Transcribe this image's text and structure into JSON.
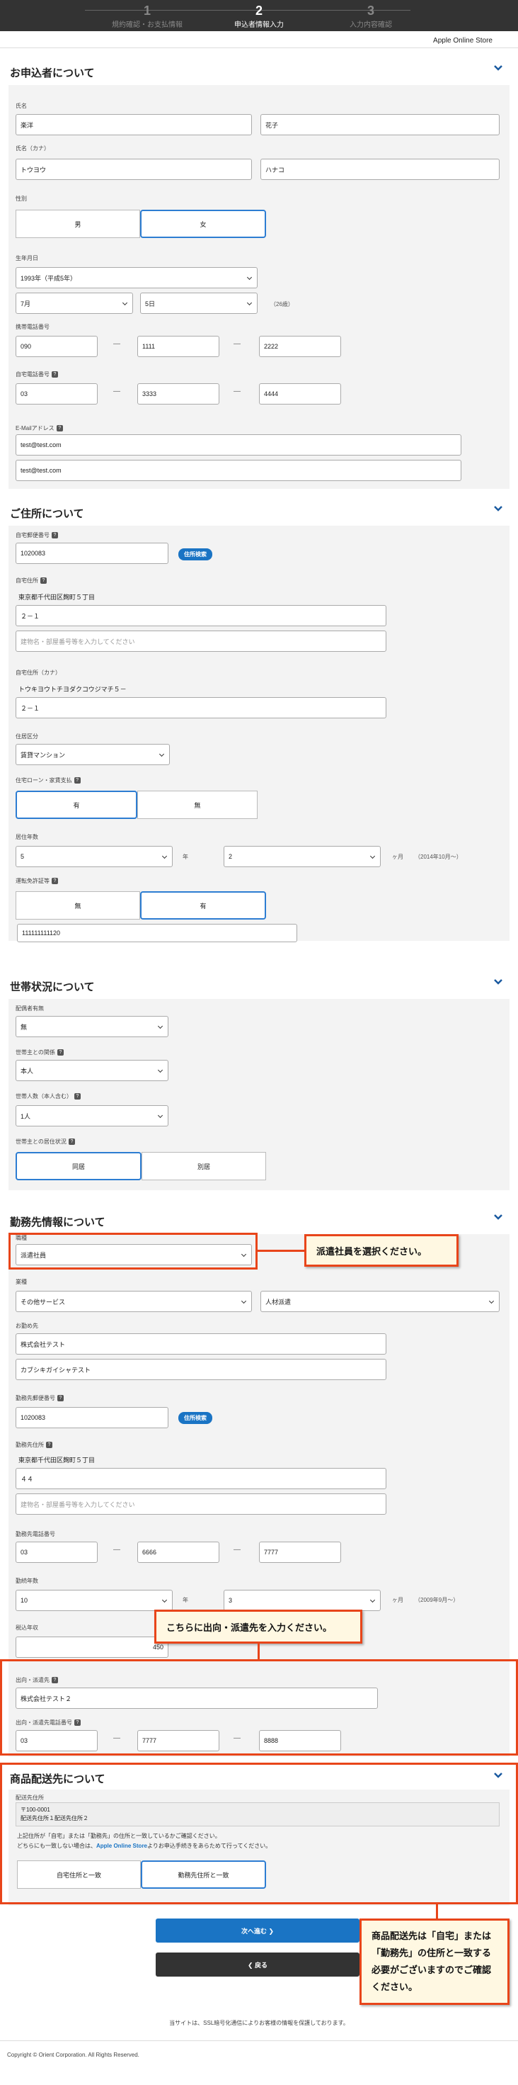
{
  "steps": [
    {
      "num": "1",
      "label": "規約確認・お支払情報"
    },
    {
      "num": "2",
      "label": "申込者情報入力"
    },
    {
      "num": "3",
      "label": "入力内容確認"
    }
  ],
  "store": "Apple Online Store",
  "applicant": {
    "title": "お申込者について",
    "name_label": "氏名",
    "last": "楽洋",
    "first": "花子",
    "kana_label": "氏名（カナ）",
    "last_kana": "トウヨウ",
    "first_kana": "ハナコ",
    "gender_label": "性別",
    "male": "男",
    "female": "女",
    "birth_label": "生年月日",
    "year": "1993年（平成5年）",
    "month": "7月",
    "day": "5日",
    "age": "（26歳）",
    "mobile_label": "携帯電話番号",
    "m1": "090",
    "m2": "1111",
    "m3": "2222",
    "home_label": "自宅電話番号",
    "h1": "03",
    "h2": "3333",
    "h3": "4444",
    "email_label": "E-Mailアドレス",
    "email": "test@test.com",
    "email2": "test@test.com",
    "dash": "—"
  },
  "address": {
    "title": "ご住所について",
    "zip_label": "自宅郵便番号",
    "zip": "1020083",
    "search": "住所検索",
    "addr_label": "自宅住所",
    "addr_fixed": "東京都千代田区麹町５丁目",
    "addr1": "２－１",
    "addr2_ph": "建物名・部屋番号等を入力してください",
    "kana_label": "自宅住所（カナ）",
    "kana_fixed": "トウキヨウトチヨダクコウジマチ５－",
    "kana1": "２－１",
    "type_label": "住居区分",
    "type": "賃貸マンション",
    "loan_label": "住宅ローン・家賃支払",
    "loan_yes": "有",
    "loan_no": "無",
    "years_label": "居住年数",
    "years": "5",
    "year_unit": "年",
    "months": "2",
    "month_unit": "ヶ月",
    "since": "（2014年10月～）",
    "license_label": "運転免許証等",
    "lic_no": "無",
    "lic_yes": "有",
    "lic_num": "111111111120"
  },
  "household": {
    "title": "世帯状況について",
    "spouse_label": "配偶者有無",
    "spouse": "無",
    "head_label": "世帯主との関係",
    "head": "本人",
    "count_label": "世帯人数（本人含む）",
    "count": "1人",
    "live_label": "世帯主との居住状況",
    "same": "同居",
    "separate": "別居"
  },
  "work": {
    "title": "勤務先情報について",
    "job_label": "職種",
    "job": "派遣社員",
    "callout1": "派遣社員を選択ください。",
    "industry_label": "業種",
    "industry": "その他サービス",
    "industry2": "人材派遣",
    "company_label": "お勤め先",
    "company": "株式会社テスト",
    "company_kana": "カブシキガイシャテスト",
    "zip_label": "勤務先郵便番号",
    "zip": "1020083",
    "search": "住所検索",
    "addr_label": "勤務先住所",
    "addr_fixed": "東京都千代田区麹町５丁目",
    "addr1": "４４",
    "addr2_ph": "建物名・部屋番号等を入力してください",
    "tel_label": "勤務先電話番号",
    "t1": "03",
    "t2": "6666",
    "t3": "7777",
    "years_label": "勤続年数",
    "years": "10",
    "year_unit": "年",
    "months": "3",
    "month_unit": "ヶ月",
    "since": "（2009年9月～）",
    "income_label": "税込年収",
    "income": "450",
    "callout2": "こちらに出向・派遣先を入力ください。",
    "dispatch_label": "出向・派遣先",
    "dispatch": "株式会社テスト２",
    "dtel_label": "出向・派遣先電話番号",
    "d1": "03",
    "d2": "7777",
    "d3": "8888"
  },
  "delivery": {
    "title": "商品配送先について",
    "label": "配送先住所",
    "addr_line1": "〒100-0001",
    "addr_line2": "配送先住所１配送先住所２",
    "note1": "上記住所が「自宅」または「勤務先」の住所と一致しているかご確認ください。",
    "note2a": "どちらにも一致しない場合は、",
    "note2b": "Apple Online Store",
    "note2c": "よりお申込手続きをあらためて行ってください。",
    "home": "自宅住所と一致",
    "work": "勤務先住所と一致",
    "callout3": "商品配送先は「自宅」または「勤務先」の住所と一致する必要がございますのでご確認ください。"
  },
  "buttons": {
    "next": "次へ進む ❯",
    "back": "❮ 戻る"
  },
  "footer": {
    "ssl": "当サイトは、SSL暗号化通信によりお客様の情報を保護しております。",
    "copy": "Copyright © Orient Corporation. All Rights Reserved."
  },
  "colors": {
    "accent": "#1a74c4",
    "highlight": "#e8451a",
    "callout_bg": "#fff8e2"
  }
}
